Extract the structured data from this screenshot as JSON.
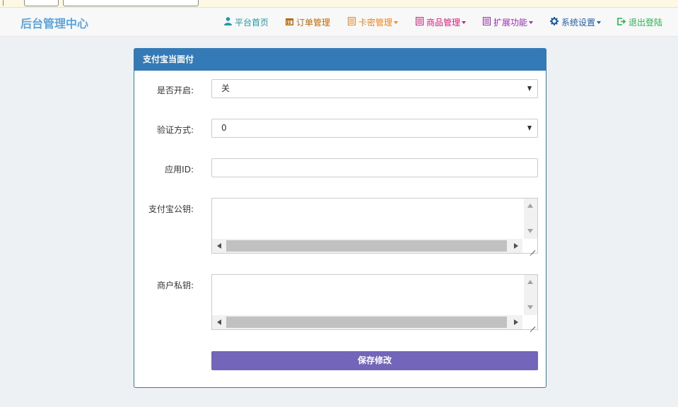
{
  "brand": "后台管理中心",
  "nav": [
    {
      "label": "平台首页",
      "icon": "user-icon",
      "dropdown": false
    },
    {
      "label": "订单管理",
      "icon": "calendar-icon",
      "dropdown": false
    },
    {
      "label": "卡密管理",
      "icon": "list-icon",
      "dropdown": true
    },
    {
      "label": "商品管理",
      "icon": "list-icon",
      "dropdown": true
    },
    {
      "label": "扩展功能",
      "icon": "list-icon",
      "dropdown": true
    },
    {
      "label": "系统设置",
      "icon": "gear-icon",
      "dropdown": true
    },
    {
      "label": "退出登陆",
      "icon": "logout-icon",
      "dropdown": false
    }
  ],
  "panel": {
    "title": "支付宝当面付",
    "fields": {
      "enabled": {
        "label": "是否开启:",
        "value": "关"
      },
      "verify": {
        "label": "验证方式:",
        "value": "0"
      },
      "appid": {
        "label": "应用ID:",
        "value": ""
      },
      "alipay_pubkey": {
        "label": "支付宝公钥:",
        "value": ""
      },
      "merchant_privkey": {
        "label": "商户私钥:",
        "value": ""
      }
    },
    "save_label": "保存修改"
  }
}
